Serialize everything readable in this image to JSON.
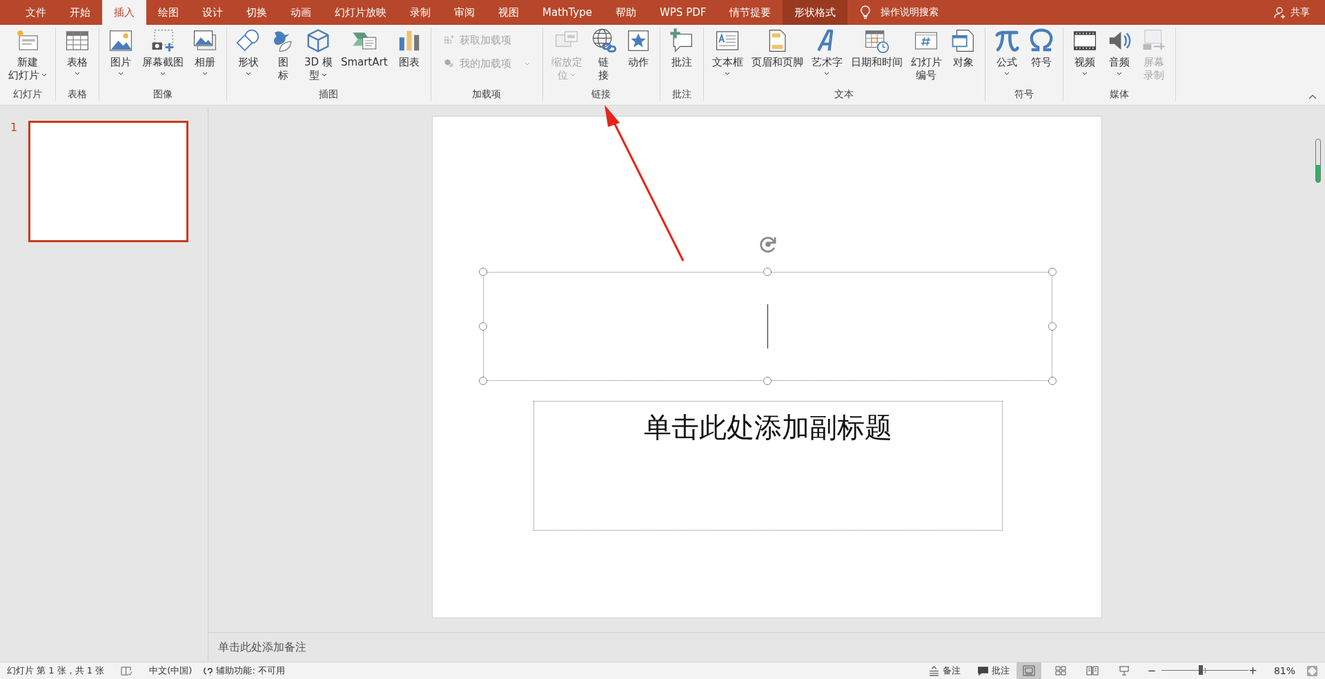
{
  "tabs": [
    {
      "label": "文件",
      "selected": false,
      "kind": "normal"
    },
    {
      "label": "开始",
      "selected": false,
      "kind": "normal"
    },
    {
      "label": "插入",
      "selected": true,
      "kind": "normal"
    },
    {
      "label": "绘图",
      "selected": false,
      "kind": "normal"
    },
    {
      "label": "设计",
      "selected": false,
      "kind": "normal"
    },
    {
      "label": "切换",
      "selected": false,
      "kind": "normal"
    },
    {
      "label": "动画",
      "selected": false,
      "kind": "normal"
    },
    {
      "label": "幻灯片放映",
      "selected": false,
      "kind": "normal"
    },
    {
      "label": "录制",
      "selected": false,
      "kind": "normal"
    },
    {
      "label": "审阅",
      "selected": false,
      "kind": "normal"
    },
    {
      "label": "视图",
      "selected": false,
      "kind": "normal"
    },
    {
      "label": "MathType",
      "selected": false,
      "kind": "normal"
    },
    {
      "label": "帮助",
      "selected": false,
      "kind": "normal"
    },
    {
      "label": "WPS PDF",
      "selected": false,
      "kind": "normal"
    },
    {
      "label": "情节提要",
      "selected": false,
      "kind": "normal"
    },
    {
      "label": "形状格式",
      "selected": false,
      "kind": "contextual"
    }
  ],
  "search": {
    "placeholder": "操作说明搜索"
  },
  "share": "共享",
  "ribbon": [
    {
      "label": "幻灯片",
      "buttons": [
        {
          "kind": "large",
          "lines": [
            "新建",
            "幻灯片"
          ],
          "dropdown": true,
          "disabled": false
        }
      ]
    },
    {
      "label": "表格",
      "buttons": [
        {
          "kind": "large",
          "lines": [
            "表格"
          ],
          "dropdown": true,
          "disabled": false
        }
      ]
    },
    {
      "label": "图像",
      "buttons": [
        {
          "kind": "large",
          "lines": [
            "图片"
          ],
          "dropdown": true,
          "disabled": false
        },
        {
          "kind": "large",
          "lines": [
            "屏幕截图"
          ],
          "dropdown": true,
          "disabled": false
        },
        {
          "kind": "large",
          "lines": [
            "相册"
          ],
          "dropdown": true,
          "disabled": false
        }
      ]
    },
    {
      "label": "插图",
      "buttons": [
        {
          "kind": "large",
          "lines": [
            "形状"
          ],
          "dropdown": true,
          "disabled": false
        },
        {
          "kind": "large",
          "lines": [
            "图",
            "标"
          ],
          "dropdown": false,
          "disabled": false
        },
        {
          "kind": "large",
          "lines": [
            "3D 模",
            "型"
          ],
          "dropdown": true,
          "disabled": false
        },
        {
          "kind": "large",
          "lines": [
            "SmartArt"
          ],
          "dropdown": false,
          "disabled": false
        },
        {
          "kind": "large",
          "lines": [
            "图表"
          ],
          "dropdown": false,
          "disabled": false
        }
      ]
    },
    {
      "label": "加载项",
      "buttons": [
        {
          "kind": "small",
          "lines": [
            "获取加载项"
          ],
          "dropdown": false,
          "disabled": true
        },
        {
          "kind": "small",
          "lines": [
            "我的加载项"
          ],
          "dropdown": true,
          "disabled": true
        }
      ]
    },
    {
      "label": "链接",
      "buttons": [
        {
          "kind": "large",
          "lines": [
            "缩放定",
            "位"
          ],
          "dropdown": true,
          "disabled": true
        },
        {
          "kind": "large",
          "lines": [
            "链",
            "接"
          ],
          "dropdown": false,
          "disabled": false
        },
        {
          "kind": "large",
          "lines": [
            "动作"
          ],
          "dropdown": false,
          "disabled": false
        }
      ]
    },
    {
      "label": "批注",
      "buttons": [
        {
          "kind": "large",
          "lines": [
            "批注"
          ],
          "dropdown": false,
          "disabled": false
        }
      ]
    },
    {
      "label": "文本",
      "buttons": [
        {
          "kind": "large",
          "lines": [
            "文本框"
          ],
          "dropdown": true,
          "disabled": false
        },
        {
          "kind": "large",
          "lines": [
            "页眉和页脚"
          ],
          "dropdown": false,
          "disabled": false
        },
        {
          "kind": "large",
          "lines": [
            "艺术字"
          ],
          "dropdown": true,
          "disabled": false
        },
        {
          "kind": "large",
          "lines": [
            "日期和时间"
          ],
          "dropdown": false,
          "disabled": false
        },
        {
          "kind": "large",
          "lines": [
            "幻灯片",
            "编号"
          ],
          "dropdown": false,
          "disabled": false
        },
        {
          "kind": "large",
          "lines": [
            "对象"
          ],
          "dropdown": false,
          "disabled": false
        }
      ]
    },
    {
      "label": "符号",
      "buttons": [
        {
          "kind": "large",
          "lines": [
            "公式"
          ],
          "dropdown": true,
          "disabled": false
        },
        {
          "kind": "large",
          "lines": [
            "符号"
          ],
          "dropdown": false,
          "disabled": false
        }
      ]
    },
    {
      "label": "媒体",
      "buttons": [
        {
          "kind": "large",
          "lines": [
            "视频"
          ],
          "dropdown": true,
          "disabled": false
        },
        {
          "kind": "large",
          "lines": [
            "音频"
          ],
          "dropdown": true,
          "disabled": false
        },
        {
          "kind": "large",
          "lines": [
            "屏幕",
            "录制"
          ],
          "dropdown": false,
          "disabled": true
        }
      ]
    }
  ],
  "thumbnails": [
    {
      "number": "1",
      "selected": true
    }
  ],
  "slide": {
    "subtitle": "单击此处添加副标题"
  },
  "notes": {
    "placeholder": "单击此处添加备注"
  },
  "status_bar": {
    "slide_info": "幻灯片 第 1 张，共 1 张",
    "language": "中文(中国)",
    "accessibility": "辅助功能: 不可用",
    "notes_button": "备注",
    "comments_button": "批注",
    "views": [
      {
        "selected": true
      },
      {
        "selected": false
      },
      {
        "selected": false
      },
      {
        "selected": false
      }
    ],
    "zoom": {
      "minus": "−",
      "plus": "+",
      "level": 0.45,
      "percent": "81%"
    }
  }
}
